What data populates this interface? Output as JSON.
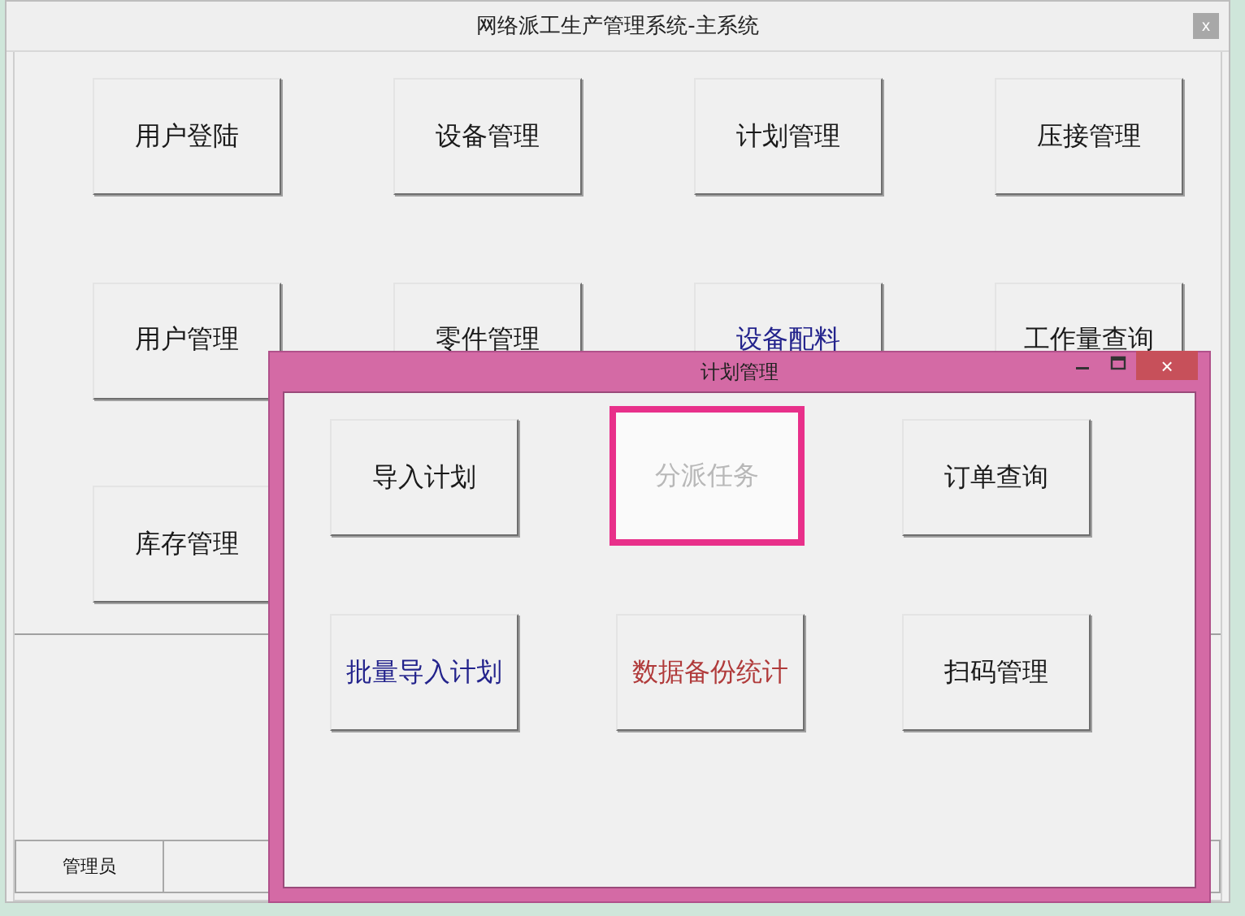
{
  "main_window": {
    "title": "网络派工生产管理系统-主系统",
    "close_symbol": "x",
    "buttons": [
      {
        "label": "用户登陆",
        "color": "#1a1a1a"
      },
      {
        "label": "设备管理",
        "color": "#1a1a1a"
      },
      {
        "label": "计划管理",
        "color": "#1a1a1a"
      },
      {
        "label": "压接管理",
        "color": "#1a1a1a"
      },
      {
        "label": "用户管理",
        "color": "#1a1a1a"
      },
      {
        "label": "零件管理",
        "color": "#1a1a1a"
      },
      {
        "label": "设备配料",
        "color": "#23238c"
      },
      {
        "label": "工作量查询",
        "color": "#1a1a1a"
      },
      {
        "label": "库存管理",
        "color": "#1a1a1a"
      }
    ],
    "status_bar": [
      "管理员"
    ]
  },
  "dialog": {
    "title": "计划管理",
    "close_symbol": "×",
    "buttons": [
      {
        "label": "导入计划",
        "color": "#1a1a1a",
        "disabled": false,
        "focused": false
      },
      {
        "label": "分派任务",
        "disabled": true,
        "focused": true
      },
      {
        "label": "订单查询",
        "color": "#1a1a1a",
        "disabled": false,
        "focused": false
      },
      {
        "label": "批量导入计划",
        "color": "#23238c",
        "disabled": false,
        "focused": false
      },
      {
        "label": "数据备份统计",
        "color": "#b03a3a",
        "disabled": false,
        "focused": false
      },
      {
        "label": "扫码管理",
        "color": "#1a1a1a",
        "disabled": false,
        "focused": false
      }
    ]
  }
}
